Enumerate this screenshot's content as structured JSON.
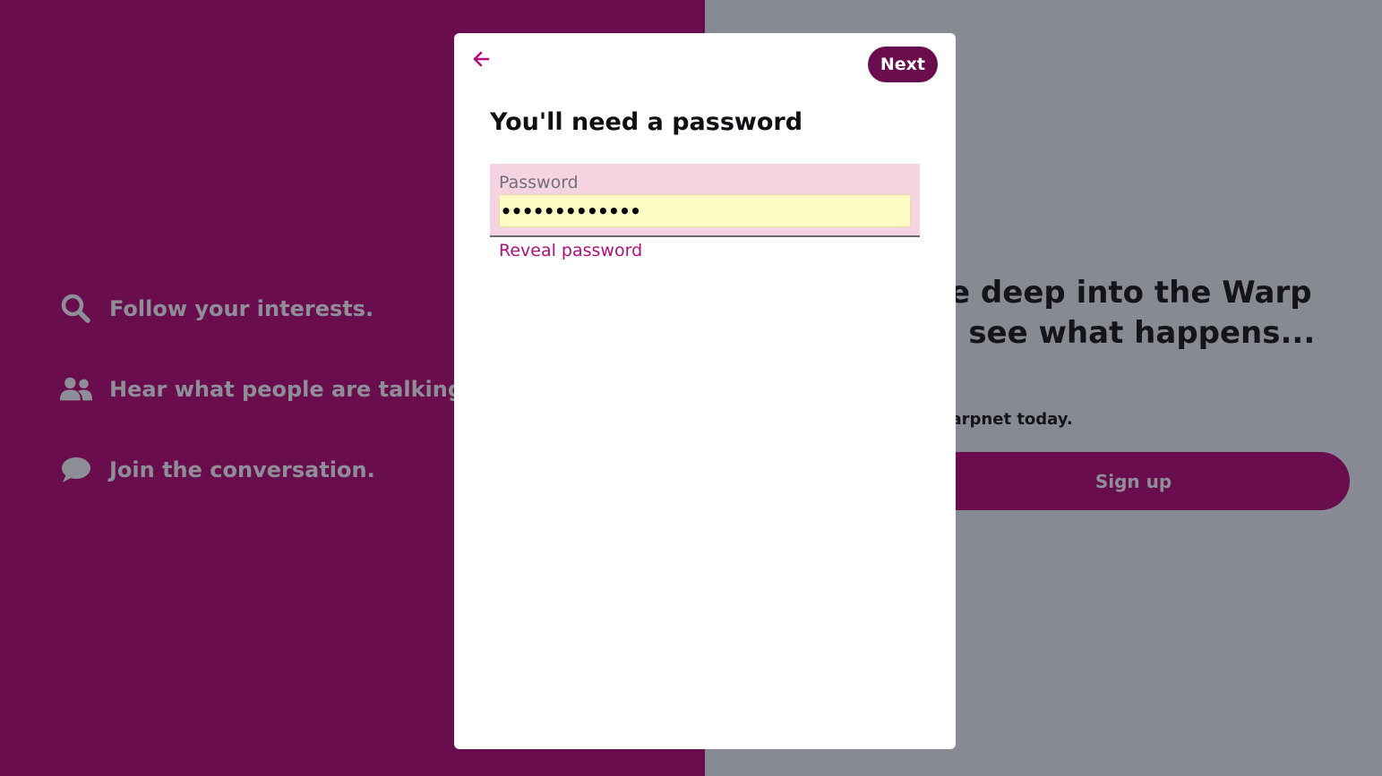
{
  "background": {
    "features": [
      {
        "icon": "search-icon",
        "label": "Follow your interests."
      },
      {
        "icon": "people-icon",
        "label": "Hear what people are talking about."
      },
      {
        "icon": "chat-bubble-icon",
        "label": "Join the conversation."
      }
    ],
    "headline": "Dive deep into the Warp\nand see what happens...",
    "join_text": "Join Warpnet today.",
    "signup_label": "Sign up"
  },
  "modal": {
    "back_icon": "arrow-left-icon",
    "next_label": "Next",
    "title": "You'll need a password",
    "password": {
      "label": "Password",
      "value": "•••••••••••••"
    },
    "reveal_label": "Reveal password"
  },
  "colors": {
    "brand": "#6a0d4f",
    "accent_link": "#b00f7a",
    "muted_text": "#8e8f96",
    "right_panel": "#878a92",
    "field_background": "#f5d3e1",
    "autofill_background": "#fffbc4"
  }
}
